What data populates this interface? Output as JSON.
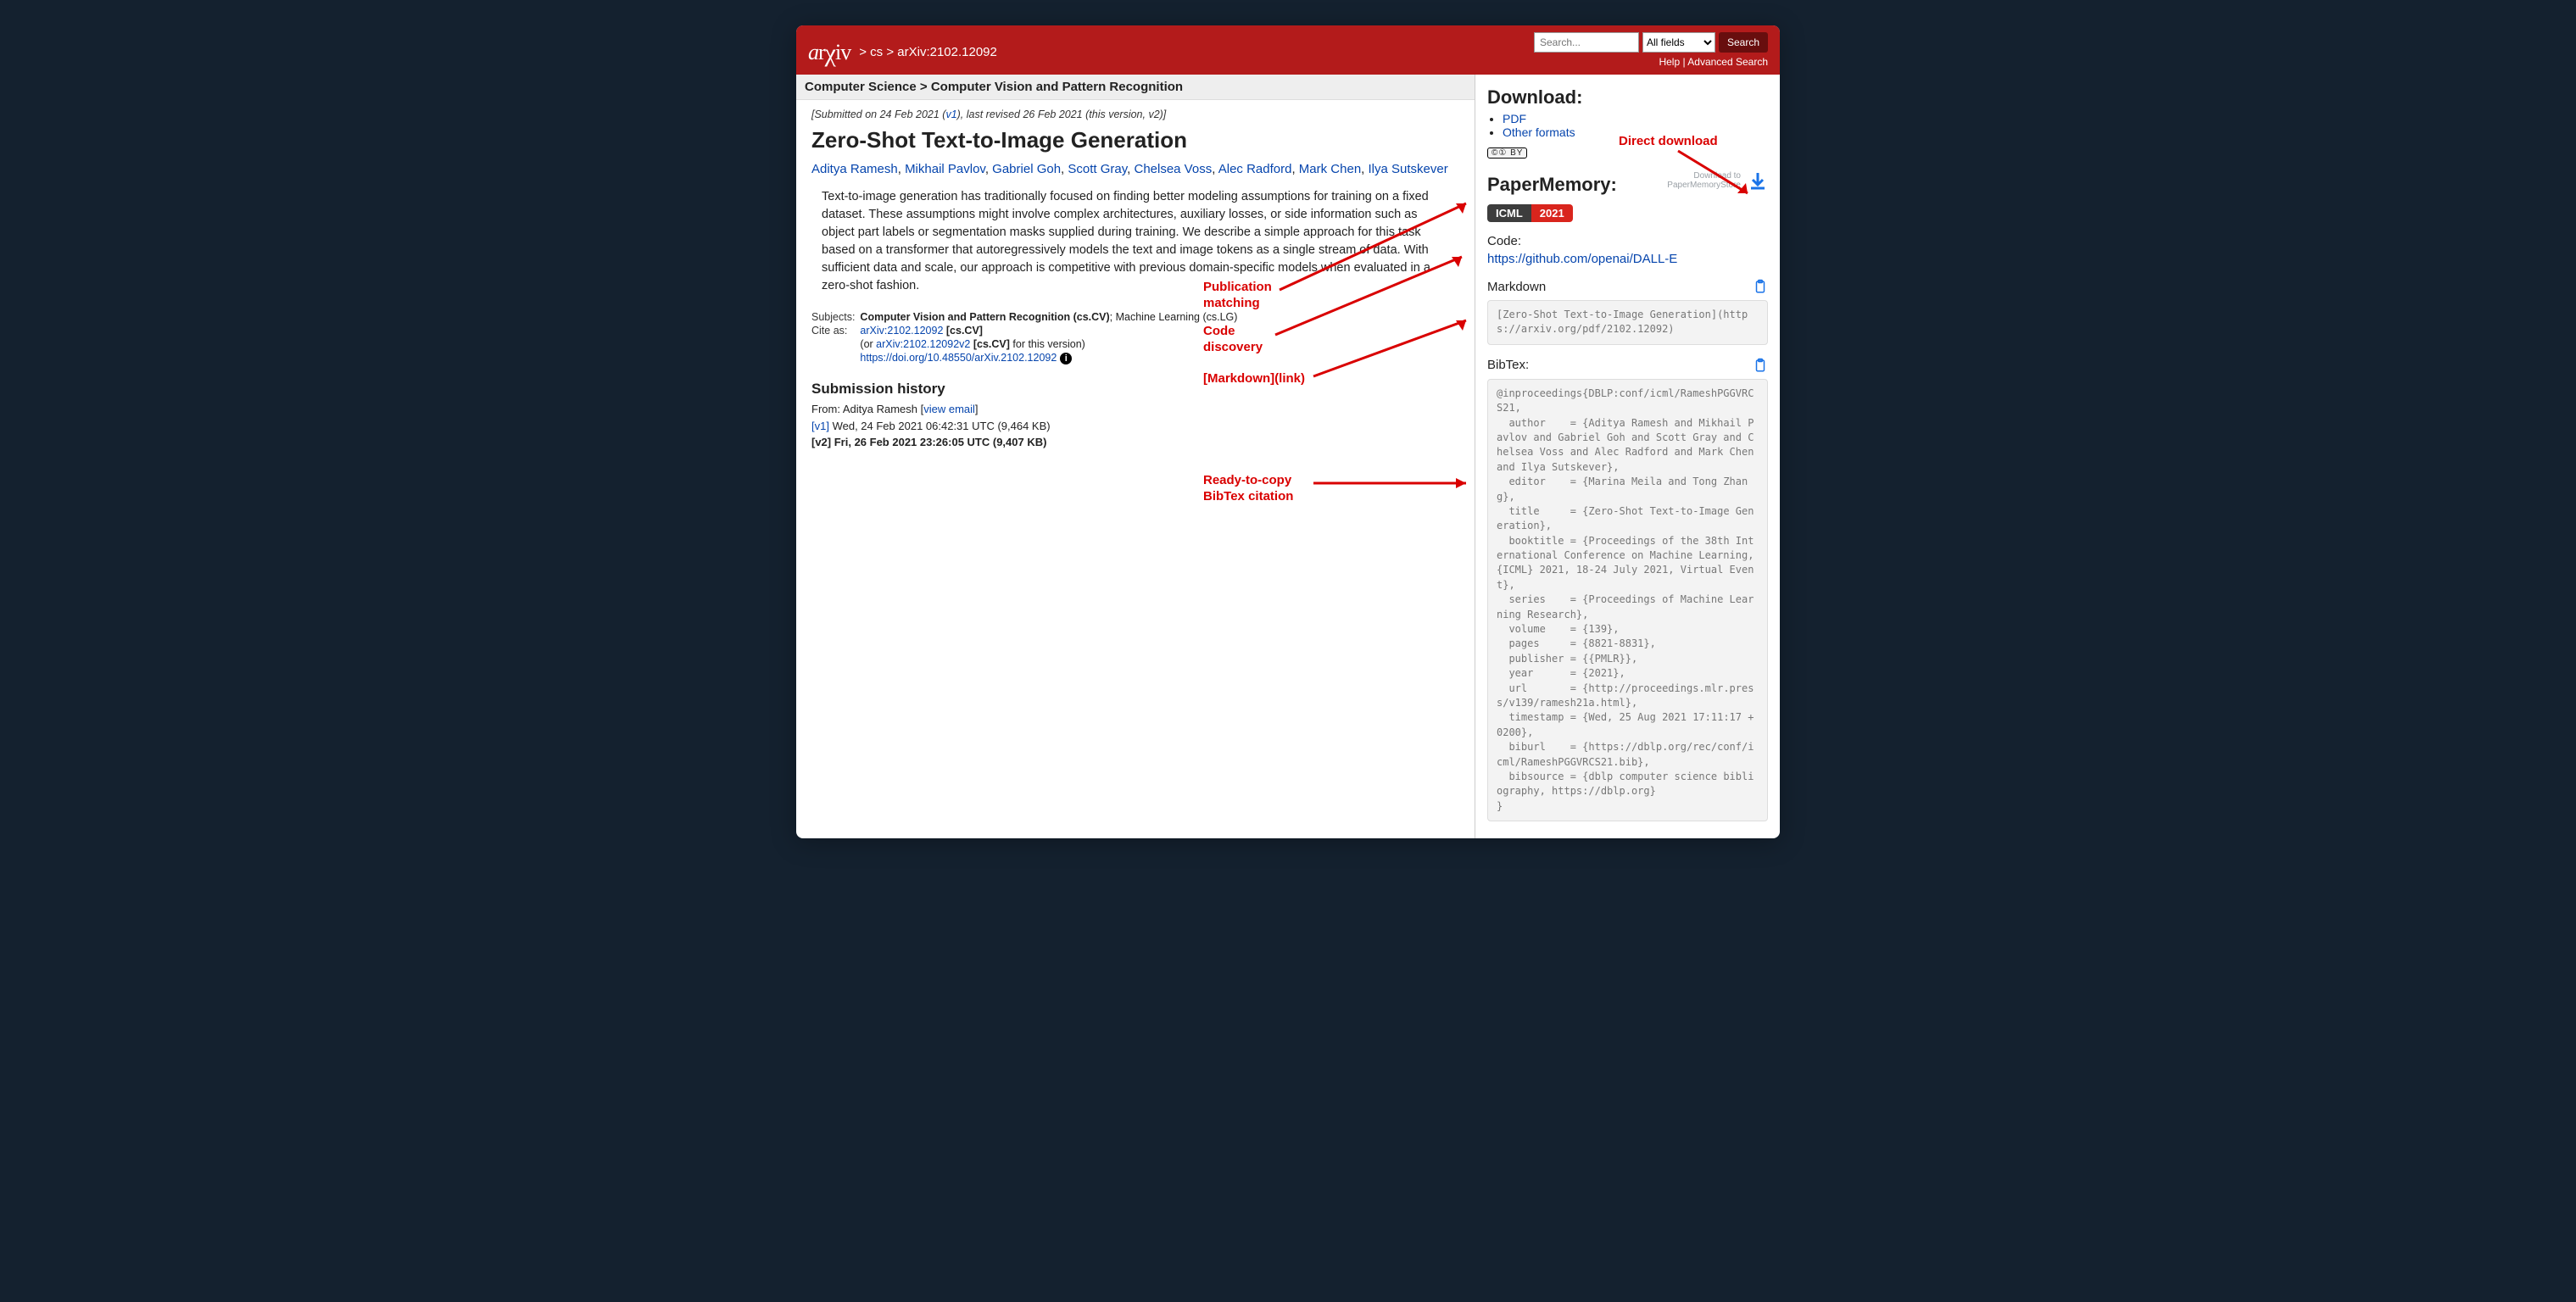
{
  "banner": {
    "bc_cs": "cs",
    "bc_id": "arXiv:2102.12092",
    "help": "Help",
    "adv": "Advanced Search",
    "search_placeholder": "Search...",
    "field": "All fields",
    "search_btn": "Search"
  },
  "catbar": {
    "parent": "Computer Science",
    "child": "Computer Vision and Pattern Recognition"
  },
  "article": {
    "submitted_pre": "[Submitted on 24 Feb 2021 (",
    "v1": "v1",
    "submitted_post": "), last revised 26 Feb 2021 (this version, v2)]",
    "title": "Zero-Shot Text-to-Image Generation",
    "authors": [
      "Aditya Ramesh",
      "Mikhail Pavlov",
      "Gabriel Goh",
      "Scott Gray",
      "Chelsea Voss",
      "Alec Radford",
      "Mark Chen",
      "Ilya Sutskever"
    ],
    "abstract": "Text-to-image generation has traditionally focused on finding better modeling assumptions for training on a fixed dataset. These assumptions might involve complex architectures, auxiliary losses, or side information such as object part labels or segmentation masks supplied during training. We describe a simple approach for this task based on a transformer that autoregressively models the text and image tokens as a single stream of data. With sufficient data and scale, our approach is competitive with previous domain-specific models when evaluated in a zero-shot fashion.",
    "meta": {
      "subjects_label": "Subjects:",
      "subjects_primary": "Computer Vision and Pattern Recognition (cs.CV)",
      "subjects_secondary": "; Machine Learning (cs.LG)",
      "citeas_label": "Cite as:",
      "citeas_1a": "arXiv:2102.12092",
      "citeas_1b": " [cs.CV]",
      "citeas_2pre": "(or ",
      "citeas_2a": "arXiv:2102.12092v2",
      "citeas_2b": " [cs.CV]",
      "citeas_2suf": " for this version)",
      "doi": "https://doi.org/10.48550/arXiv.2102.12092"
    },
    "sh_title": "Submission history",
    "sh_from_pre": "From: Aditya Ramesh [",
    "sh_from_link": "view email",
    "sh_from_post": "]",
    "sh_v1_link": "[v1]",
    "sh_v1_rest": " Wed, 24 Feb 2021 06:42:31 UTC (9,464 KB)",
    "sh_v2": "[v2] Fri, 26 Feb 2021 23:26:05 UTC (9,407 KB)"
  },
  "side": {
    "dl_title": "Download:",
    "pdf": "PDF",
    "other": "Other formats",
    "cc": "cc BY",
    "pm_title": "PaperMemory:",
    "venue": "ICML",
    "year": "2021",
    "dl_to": "Download to\nPaperMemoryStore",
    "code_label": "Code:",
    "code_url": "https://github.com/openai/DALL-E",
    "md_label": "Markdown",
    "md_text": "[Zero-Shot Text-to-Image Generation](https://arxiv.org/pdf/2102.12092)",
    "bib_label": "BibTex:",
    "bib_text": "@inproceedings{DBLP:conf/icml/RameshPGGVRCS21,\n  author    = {Aditya Ramesh and Mikhail Pavlov and Gabriel Goh and Scott Gray and Chelsea Voss and Alec Radford and Mark Chen and Ilya Sutskever},\n  editor    = {Marina Meila and Tong Zhang},\n  title     = {Zero-Shot Text-to-Image Generation},\n  booktitle = {Proceedings of the 38th International Conference on Machine Learning, {ICML} 2021, 18-24 July 2021, Virtual Event},\n  series    = {Proceedings of Machine Learning Research},\n  volume    = {139},\n  pages     = {8821-8831},\n  publisher = {{PMLR}},\n  year      = {2021},\n  url       = {http://proceedings.mlr.press/v139/ramesh21a.html},\n  timestamp = {Wed, 25 Aug 2021 17:11:17 +0200},\n  biburl    = {https://dblp.org/rec/conf/icml/RameshPGGVRCS21.bib},\n  bibsource = {dblp computer science bibliography, https://dblp.org}\n}"
  },
  "ann": {
    "pub": "Publication\nmatching",
    "code": "Code\ndiscovery",
    "md": "[Markdown](link)",
    "bib": "Ready-to-copy\nBibTex citation",
    "dl": "Direct download"
  }
}
